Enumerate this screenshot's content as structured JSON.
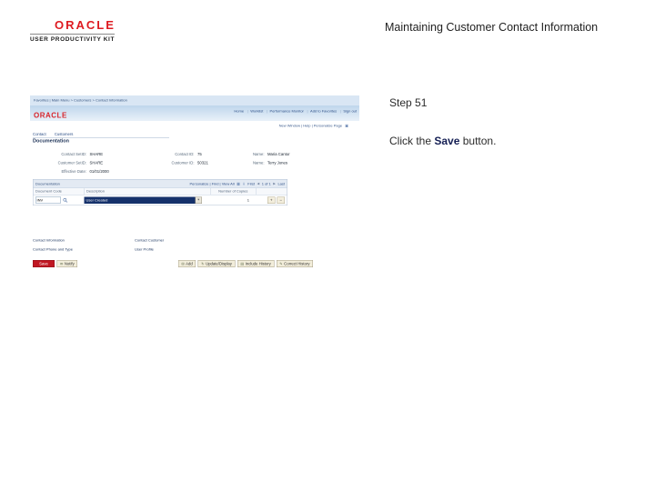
{
  "colors": {
    "oracle_red": "#de1b21",
    "save_highlight": "#c01722",
    "instruction_accent": "#151f54",
    "ps_header_blue": "#bfd6ec",
    "dropdown_selected": "#15316b"
  },
  "header": {
    "logo_brand": "ORACLE",
    "logo_sub": "USER PRODUCTIVITY KIT",
    "title": "Maintaining Customer Contact Information"
  },
  "panel": {
    "step_label": "Step 51",
    "instruction_pre": "Click the",
    "instruction_target": "Save",
    "instruction_post": "button."
  },
  "icons": {
    "new_window": "▣",
    "grid": "▦",
    "download": "⇓",
    "prev": "◀",
    "next": "▶",
    "dropdown_arrow": "▼",
    "notify": "✉",
    "add": "⊞",
    "update_display": "↻",
    "include_history": "▤",
    "correct_history": "✎",
    "row_add": "+",
    "row_delete": "−"
  },
  "shot": {
    "breadcrumb": "Favorites | Main Menu > Customers > Contact Information",
    "brand": "ORACLE",
    "header_links": [
      "Home",
      "Worklist",
      "Performance Monitor",
      "Add to Favorites",
      "Sign out"
    ],
    "page_links": "New Window | Help | Personalize Page",
    "tabs": [
      "Contact",
      "Customers"
    ],
    "page_title": "Documentation",
    "fields": {
      "rows": [
        {
          "l1": "Contact SetID:",
          "v1": "SHARE",
          "l2": "Contact ID:",
          "v2": "75",
          "l3": "Name:",
          "v3": "Maria Cantor"
        },
        {
          "l1": "Customer SetID:",
          "v1": "SHARE",
          "l2": "Customer ID:",
          "v2": "50321",
          "l3": "Name:",
          "v3": "Terry Jones"
        },
        {
          "l1": "Effective Date:",
          "v1": "01/01/2000"
        }
      ]
    },
    "grid": {
      "title": "Documentation",
      "toolbar_links": "Personalize | Find | View All",
      "pager_first": "First",
      "pager_pos": "1 of 1",
      "pager_last": "Last",
      "columns": [
        "Document Code",
        "Description",
        "Number of Copies"
      ],
      "row": {
        "document_code": "INV",
        "description": "User Created",
        "copies": "1"
      }
    },
    "links": {
      "col1": [
        "Contact Information",
        "Contact Phone and Type"
      ],
      "col2": [
        "Contact Customer",
        "User Profile"
      ]
    },
    "toolbar": {
      "save": "Save",
      "notify": "Notify",
      "add": "Add",
      "update_display": "Update/Display",
      "include_history": "Include History",
      "correct_history": "Correct History"
    }
  }
}
